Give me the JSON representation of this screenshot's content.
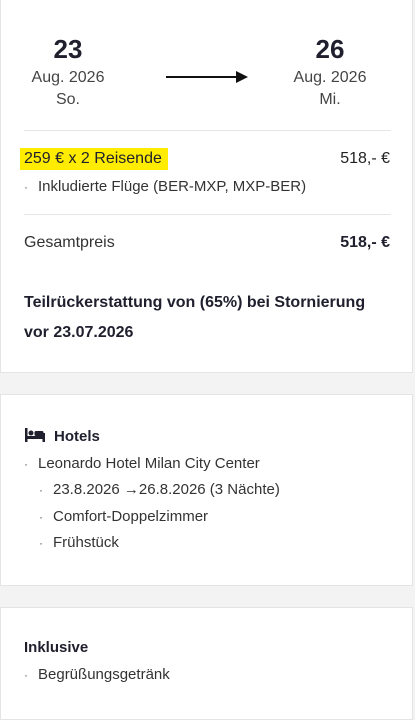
{
  "trip": {
    "departure": {
      "day": "23",
      "month": "Aug. 2026",
      "weekday": "So."
    },
    "return": {
      "day": "26",
      "month": "Aug. 2026",
      "weekday": "Mi."
    }
  },
  "pricing": {
    "line_label": "259 € x 2 Reisende",
    "line_amount": "518,- €",
    "flights_note": "Inkludierte Flüge (BER-MXP, MXP-BER)",
    "total_label": "Gesamtpreis",
    "total_amount": "518,- €"
  },
  "refund_notice": "Teilrückerstattung von (65%) bei Stornierung vor 23.07.2026",
  "hotels": {
    "title": "Hotels",
    "icon": "bed-icon",
    "hotel_name": "Leonardo Hotel Milan City Center",
    "details": [
      "23.8.2026 →26.8.2026 (3 Nächte)",
      "Comfort-Doppelzimmer",
      "Frühstück"
    ]
  },
  "inclusive": {
    "title": "Inklusive",
    "items": [
      "Begrüßungsgetränk"
    ]
  },
  "colors": {
    "highlight": "#ffec00",
    "text": "#1f1f2e"
  }
}
